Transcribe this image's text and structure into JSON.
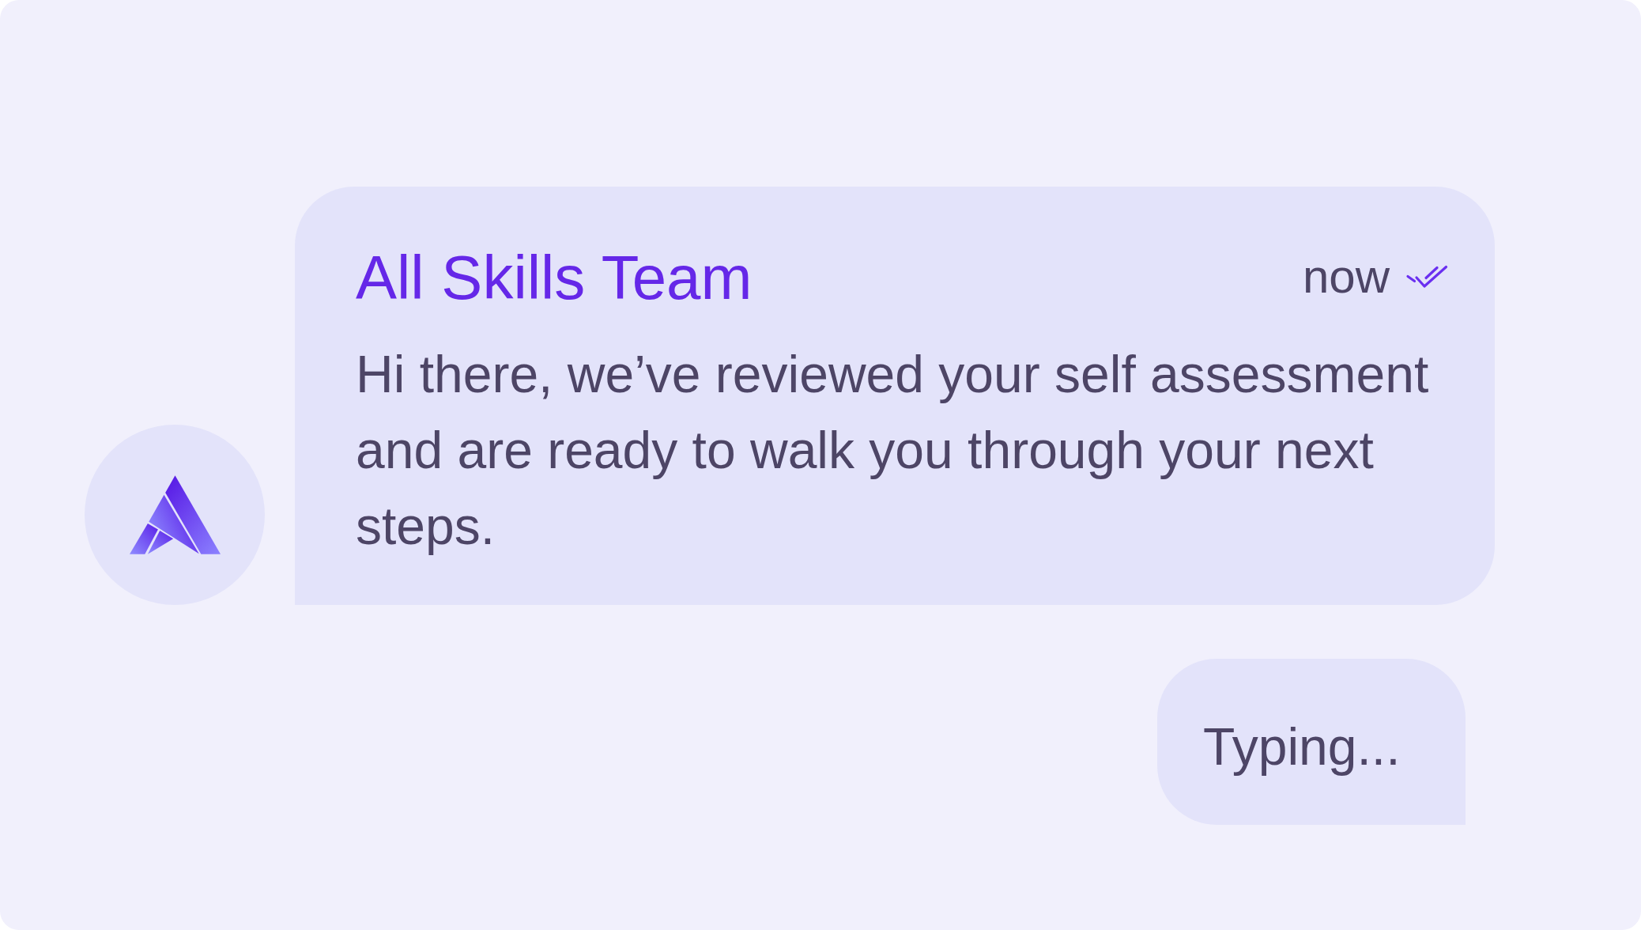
{
  "message": {
    "sender": "All Skills Team",
    "time": "now",
    "read": true,
    "text": "Hi there, we’ve reviewed your self assessment and are ready to walk you through your next steps."
  },
  "typing_bubble": {
    "text": "Typing..."
  }
}
